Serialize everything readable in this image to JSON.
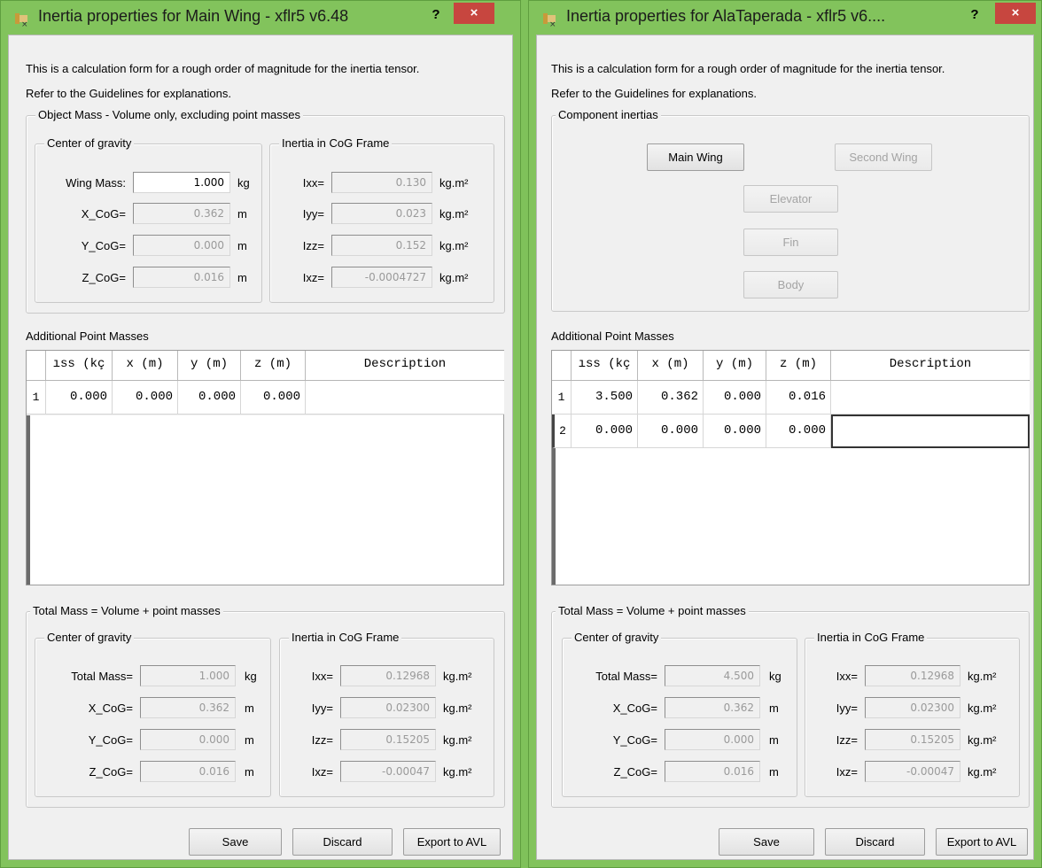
{
  "left": {
    "title": "Inertia properties for Main Wing - xflr5 v6.48",
    "help": "?",
    "close": "×",
    "intro1": "This is a calculation form for a rough order of magnitude for the inertia tensor.",
    "intro2": "Refer to the Guidelines for explanations.",
    "object_mass_group": "Object Mass - Volume only, excluding point masses",
    "cog_group": "Center of gravity",
    "inertia_group": "Inertia in CoG Frame",
    "wing_mass_label": "Wing Mass:",
    "wing_mass": "1.000",
    "xcog_label": "X_CoG=",
    "xcog": "0.362",
    "ycog_label": "Y_CoG=",
    "ycog": "0.000",
    "zcog_label": "Z_CoG=",
    "zcog": "0.016",
    "ixx_label": "Ixx=",
    "ixx": "0.130",
    "iyy_label": "Iyy=",
    "iyy": "0.023",
    "izz_label": "Izz=",
    "izz": "0.152",
    "ixz_label": "Ixz=",
    "ixz": "-0.0004727",
    "unit_kg": "kg",
    "unit_m": "m",
    "unit_kgm2": "kg.m²",
    "point_masses_label": "Additional Point Masses",
    "columns": [
      "ıss (kç",
      "x (m)",
      "y (m)",
      "z (m)",
      "Description"
    ],
    "rows": [
      {
        "num": "1",
        "mass": "0.000",
        "x": "0.000",
        "y": "0.000",
        "z": "0.000",
        "desc": ""
      }
    ],
    "total_group": "Total Mass = Volume + point masses",
    "total_cog_group": "Center of gravity",
    "total_inertia_group": "Inertia in CoG Frame",
    "total_mass_label": "Total Mass=",
    "total_mass": "1.000",
    "t_xcog": "0.362",
    "t_ycog": "0.000",
    "t_zcog": "0.016",
    "t_ixx": "0.12968",
    "t_iyy": "0.02300",
    "t_izz": "0.15205",
    "t_ixz": "-0.00047",
    "save": "Save",
    "discard": "Discard",
    "export": "Export to AVL"
  },
  "right": {
    "title": "Inertia properties for AlaTaperada - xflr5 v6....",
    "help": "?",
    "close": "×",
    "intro1": "This is a calculation form for a rough order of magnitude for the inertia tensor.",
    "intro2": "Refer to the Guidelines for explanations.",
    "component_group": "Component inertias",
    "main_wing": "Main Wing",
    "second_wing": "Second Wing",
    "elevator": "Elevator",
    "fin": "Fin",
    "body": "Body",
    "point_masses_label": "Additional Point Masses",
    "columns": [
      "ıss (kç",
      "x (m)",
      "y (m)",
      "z (m)",
      "Description"
    ],
    "rows": [
      {
        "num": "1",
        "mass": "3.500",
        "x": "0.362",
        "y": "0.000",
        "z": "0.016",
        "desc": ""
      },
      {
        "num": "2",
        "mass": "0.000",
        "x": "0.000",
        "y": "0.000",
        "z": "0.000",
        "desc": ""
      }
    ],
    "total_group": "Total Mass = Volume + point masses",
    "total_cog_group": "Center of gravity",
    "total_inertia_group": "Inertia in CoG Frame",
    "total_mass_label": "Total Mass=",
    "total_mass": "4.500",
    "xcog_label": "X_CoG=",
    "ycog_label": "Y_CoG=",
    "zcog_label": "Z_CoG=",
    "ixx_label": "Ixx=",
    "iyy_label": "Iyy=",
    "izz_label": "Izz=",
    "ixz_label": "Ixz=",
    "t_xcog": "0.362",
    "t_ycog": "0.000",
    "t_zcog": "0.016",
    "t_ixx": "0.12968",
    "t_iyy": "0.02300",
    "t_izz": "0.15205",
    "t_ixz": "-0.00047",
    "unit_kg": "kg",
    "unit_m": "m",
    "unit_kgm2": "kg.m²",
    "save": "Save",
    "discard": "Discard",
    "export": "Export to AVL"
  }
}
